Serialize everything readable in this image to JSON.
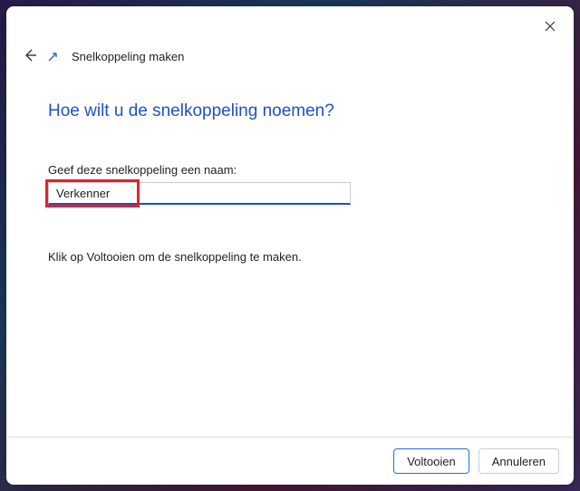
{
  "header": {
    "page_title": "Snelkoppeling maken"
  },
  "content": {
    "heading": "Hoe wilt u de snelkoppeling noemen?",
    "name_label": "Geef deze snelkoppeling een naam:",
    "name_value": "Verkenner",
    "instruction": "Klik op Voltooien om de snelkoppeling te maken."
  },
  "footer": {
    "finish_label": "Voltooien",
    "cancel_label": "Annuleren"
  }
}
